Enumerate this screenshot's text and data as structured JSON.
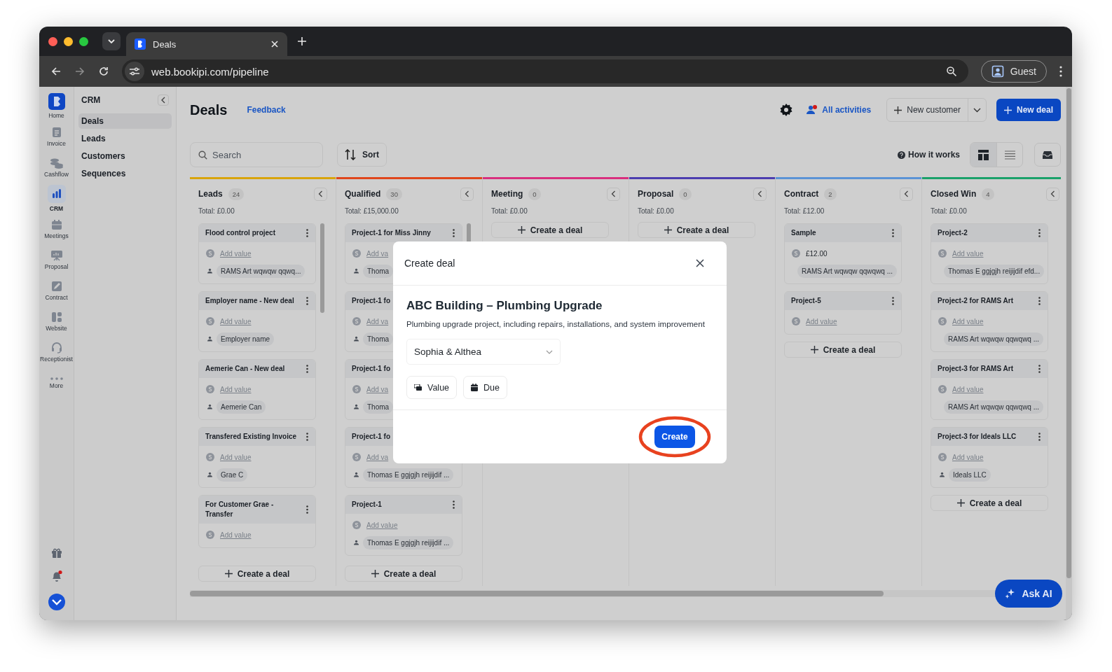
{
  "browser": {
    "tab_title": "Deals",
    "url": "web.bookipi.com/pipeline",
    "profile": "Guest"
  },
  "rail": {
    "items": [
      {
        "label": "Home",
        "selected": false
      },
      {
        "label": "Invoice",
        "selected": false
      },
      {
        "label": "Cashflow",
        "selected": false
      },
      {
        "label": "CRM",
        "selected": true
      },
      {
        "label": "Meetings",
        "selected": false
      },
      {
        "label": "Proposal",
        "selected": false
      },
      {
        "label": "Contract",
        "selected": false
      },
      {
        "label": "Website",
        "selected": false
      },
      {
        "label": "Receptionist",
        "selected": false
      },
      {
        "label": "More",
        "selected": false
      }
    ]
  },
  "sidebar": {
    "title": "CRM",
    "items": [
      {
        "label": "Deals",
        "selected": true
      },
      {
        "label": "Leads",
        "selected": false
      },
      {
        "label": "Customers",
        "selected": false
      },
      {
        "label": "Sequences",
        "selected": false
      }
    ]
  },
  "header": {
    "title": "Deals",
    "feedback": "Feedback",
    "activities": "All activities",
    "new_customer": "New customer",
    "new_deal": "New deal"
  },
  "toolbar": {
    "search": {
      "placeholder": "Search"
    },
    "sort": "Sort",
    "help": "How it works",
    "views": [
      {
        "selected": true
      },
      {
        "selected": false
      }
    ]
  },
  "columns": [
    {
      "name": "Leads",
      "count": "24",
      "total": "Total: £0.00",
      "color": "#d9a40b",
      "create": "Create a deal",
      "cards": [
        {
          "title": "Flood control project",
          "value": {
            "kind": "link",
            "text": "Add value"
          },
          "contact": "RAMS Art wqwqw qqwq..."
        },
        {
          "title": "Employer name - New deal",
          "value": {
            "kind": "link",
            "text": "Add value"
          },
          "contact": "Employer name"
        },
        {
          "title": "Aemerie Can - New deal",
          "value": {
            "kind": "link",
            "text": "Add value"
          },
          "contact": "Aemerie Can"
        },
        {
          "title": "Transfered Existing Invoice",
          "value": {
            "kind": "link",
            "text": "Add value"
          },
          "contact": "Grae C"
        },
        {
          "title": "For Customer Grae - Transfer",
          "value": {
            "kind": "link",
            "text": "Add value"
          }
        }
      ]
    },
    {
      "name": "Qualified",
      "count": "30",
      "total": "Total: £15,000.00",
      "color": "#e0461c",
      "create": "Create a deal",
      "cards": [
        {
          "title": "Project-1 for Miss Jinny",
          "value": {
            "kind": "link",
            "text": "Add va"
          },
          "contact": "Thoma"
        },
        {
          "title": "Project-1 fo",
          "value": {
            "kind": "link",
            "text": "Add va"
          },
          "contact": "Thoma"
        },
        {
          "title": "Project-1 fo",
          "value": {
            "kind": "link",
            "text": "Add va"
          },
          "contact": "Thoma"
        },
        {
          "title": "Project-1 fo",
          "value": {
            "kind": "link",
            "text": "Add va"
          },
          "contact": "Thomas E ggjgjh reijijdif ..."
        },
        {
          "title": "Project-1",
          "value": {
            "kind": "link",
            "text": "Add value"
          },
          "contact": "Thomas E ggjgjh reijijdif ..."
        }
      ]
    },
    {
      "name": "Meeting",
      "count": "0",
      "total": "Total: £0.00",
      "color": "#d92f7e",
      "create": "Create a deal"
    },
    {
      "name": "Proposal",
      "count": "0",
      "total": "Total: £0.00",
      "color": "#4b3db0",
      "create": "Create a deal"
    },
    {
      "name": "Contract",
      "count": "2",
      "total": "Total: £12.00",
      "color": "#5b93d6",
      "create": "Create a deal",
      "cards": [
        {
          "title": "Sample",
          "value": {
            "kind": "amount",
            "text": "£12.00"
          },
          "contact": "RAMS Art wqwqw qqwqwq ..."
        },
        {
          "title": "Project-5",
          "value": {
            "kind": "link",
            "text": "Add value"
          }
        }
      ]
    },
    {
      "name": "Closed Win",
      "count": "4",
      "total": "Total: £0.00",
      "color": "#1aa16a",
      "create": "Create a deal",
      "cards": [
        {
          "title": "Project-2",
          "value": {
            "kind": "link",
            "text": "Add value"
          },
          "contact": "Thomas E ggjgjh reijijdif efd..."
        },
        {
          "title": "Project-2 for RAMS Art",
          "value": {
            "kind": "link",
            "text": "Add value"
          },
          "contact": "RAMS Art wqwqw qqwqwq ..."
        },
        {
          "title": "Project-3 for RAMS Art",
          "value": {
            "kind": "link",
            "text": "Add value"
          },
          "contact": "RAMS Art wqwqw qqwqwq ..."
        },
        {
          "title": "Project-3 for Ideals LLC",
          "value": {
            "kind": "link",
            "text": "Add value"
          },
          "contact": "Ideals LLC"
        }
      ]
    }
  ],
  "modal": {
    "title": "Create deal",
    "deal_name": "ABC Building – Plumbing Upgrade",
    "description": "Plumbing upgrade project, including repairs, installations, and system improvement",
    "contact": "Sophia & Althea",
    "chips": [
      "Value",
      "Due"
    ],
    "create": {
      "label": "Create",
      "circled": true
    }
  },
  "ask_ai": "Ask AI"
}
